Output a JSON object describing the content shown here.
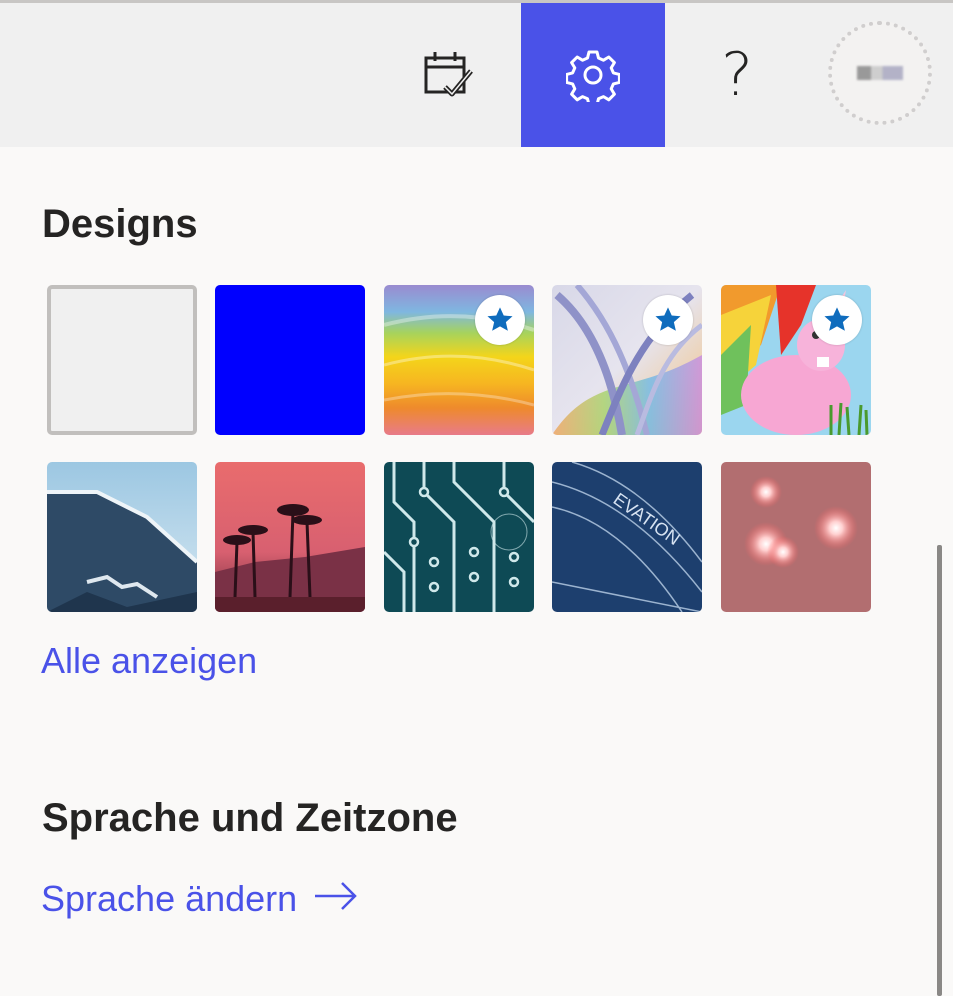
{
  "topbar": {
    "buttons": [
      {
        "name": "calendar-check-icon",
        "active": false
      },
      {
        "name": "gear-icon",
        "active": true
      },
      {
        "name": "help-icon",
        "glyph": "?",
        "active": false
      }
    ],
    "accent": "#4a52e8"
  },
  "designs": {
    "title": "Designs",
    "tiles": [
      {
        "name": "design-light",
        "selected": true,
        "premium": false
      },
      {
        "name": "design-blue",
        "selected": false,
        "premium": false
      },
      {
        "name": "design-rainbow-waves",
        "selected": false,
        "premium": true
      },
      {
        "name": "design-ribbons",
        "selected": false,
        "premium": true
      },
      {
        "name": "design-unicorn",
        "selected": false,
        "premium": true
      },
      {
        "name": "design-mountain",
        "selected": false,
        "premium": false
      },
      {
        "name": "design-palms",
        "selected": false,
        "premium": false
      },
      {
        "name": "design-circuit",
        "selected": false,
        "premium": false
      },
      {
        "name": "design-blueprint",
        "selected": false,
        "premium": false
      },
      {
        "name": "design-lights",
        "selected": false,
        "premium": false
      }
    ],
    "show_all": "Alle anzeigen"
  },
  "language": {
    "title": "Sprache und Zeitzone",
    "change_link": "Sprache ändern",
    "arrow_icon": "arrow-right-icon"
  }
}
